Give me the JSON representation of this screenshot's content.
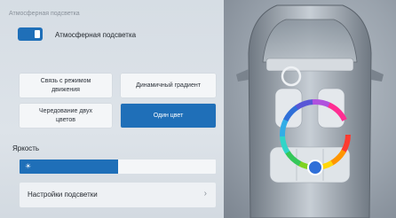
{
  "section": {
    "title": "Атмосферная подсветка"
  },
  "toggle": {
    "label": "Атмосферная подсветка",
    "on": true
  },
  "modes": [
    {
      "label": "Связь с режимом движения",
      "active": false
    },
    {
      "label": "Динамичный градиент",
      "active": false
    },
    {
      "label": "Чередование двух цветов",
      "active": false
    },
    {
      "label": "Один цвет",
      "active": true
    }
  ],
  "brightness": {
    "label": "Яркость",
    "level_percent": 50,
    "icon": "sun-icon"
  },
  "settings": {
    "label": "Настройки подсветки",
    "icon": "chevron-right-icon"
  },
  "color_wheel": {
    "selected_color": "#2f6fd8"
  },
  "colors": {
    "accent": "#1f6fb8",
    "button_bg": "#f4f6f8",
    "panel_bg": "#d6dde4"
  }
}
